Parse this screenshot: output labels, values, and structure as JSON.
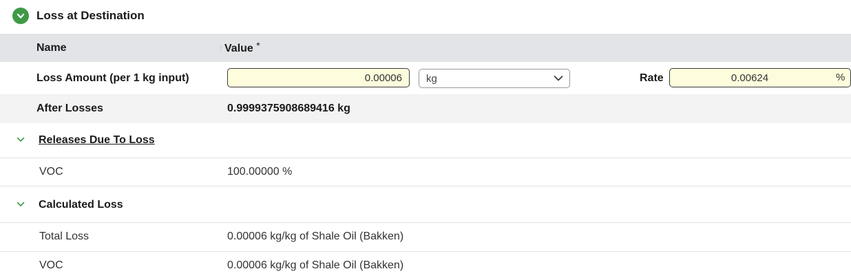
{
  "section": {
    "title": "Loss at Destination"
  },
  "table_header": {
    "name_label": "Name",
    "value_label": "Value",
    "required_marker": "*",
    "handle_glyph": "⋮"
  },
  "loss_amount": {
    "label": "Loss Amount (per 1 kg input)",
    "value": "0.00006",
    "unit": "kg",
    "rate_label": "Rate",
    "rate_value": "0.00624",
    "rate_unit": "%"
  },
  "after_losses": {
    "label": "After Losses",
    "value": "0.9999375908689416 kg"
  },
  "releases": {
    "title": "Releases Due To Loss",
    "items": [
      {
        "name": "VOC",
        "value": "100.00000 %"
      }
    ]
  },
  "calculated_loss": {
    "title": "Calculated Loss",
    "items": [
      {
        "name": "Total Loss",
        "value": "0.00006 kg/kg of Shale Oil (Bakken)"
      },
      {
        "name": "VOC",
        "value": "0.00006 kg/kg of Shale Oil (Bakken)"
      }
    ]
  },
  "colors": {
    "accent": "#3e9a45",
    "header_bg": "#e3e4e8",
    "input_bg": "#fdfcdc",
    "alt_row_bg": "#f3f3f3"
  },
  "icons": {
    "section_toggle": "chevron-down-circle-icon",
    "select_arrow": "chevron-down-icon",
    "subsection_toggle": "chevron-down-icon"
  }
}
